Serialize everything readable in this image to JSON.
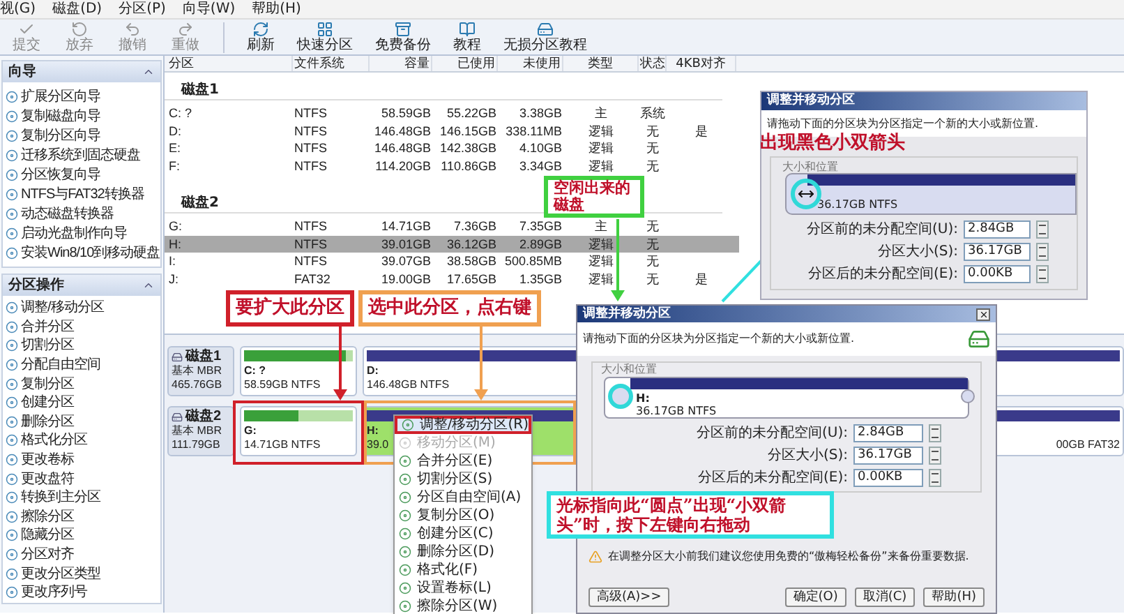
{
  "menu_bar": [
    "视(G)",
    "磁盘(D)",
    "分区(P)",
    "向导(W)",
    "帮助(H)"
  ],
  "toolbar": [
    {
      "label": "提交",
      "disabled": true
    },
    {
      "label": "放弃",
      "disabled": true
    },
    {
      "label": "撤销",
      "disabled": true
    },
    {
      "label": "重做",
      "disabled": true
    },
    {
      "label": "刷新",
      "disabled": false
    },
    {
      "label": "快速分区",
      "disabled": false
    },
    {
      "label": "免费备份",
      "disabled": false
    },
    {
      "label": "教程",
      "disabled": false
    },
    {
      "label": "无损分区教程",
      "disabled": false
    }
  ],
  "sidebar": [
    {
      "title": "向导",
      "items": [
        "扩展分区向导",
        "复制磁盘向导",
        "复制分区向导",
        "迁移系统到固态硬盘",
        "分区恢复向导",
        "NTFS与FAT32转换器",
        "动态磁盘转换器",
        "启动光盘制作向导",
        "安装Win8/10到移动硬盘"
      ]
    },
    {
      "title": "分区操作",
      "items": [
        "调整/移动分区",
        "合并分区",
        "切割分区",
        "分配自由空间",
        "复制分区",
        "创建分区",
        "删除分区",
        "格式化分区",
        "更改卷标",
        "更改盘符",
        "转换到主分区",
        "擦除分区",
        "隐藏分区",
        "分区对齐",
        "更改分区类型",
        "更改序列号"
      ]
    }
  ],
  "table": {
    "columns": [
      "分区",
      "文件系统",
      "容量",
      "已使用",
      "未使用",
      "类型",
      "状态",
      "4KB对齐"
    ],
    "disks": [
      {
        "name": "磁盘1",
        "rows": [
          {
            "cells": [
              "C: ?",
              "NTFS",
              "58.59GB",
              "55.22GB",
              "3.38GB",
              "主",
              "系统",
              ""
            ],
            "selected": false
          },
          {
            "cells": [
              "D:",
              "NTFS",
              "146.48GB",
              "146.15GB",
              "338.11MB",
              "逻辑",
              "无",
              "是"
            ],
            "selected": false
          },
          {
            "cells": [
              "E:",
              "NTFS",
              "146.48GB",
              "142.38GB",
              "4.10GB",
              "逻辑",
              "无",
              ""
            ],
            "selected": false
          },
          {
            "cells": [
              "F:",
              "NTFS",
              "114.20GB",
              "110.86GB",
              "3.34GB",
              "逻辑",
              "无",
              ""
            ],
            "selected": false
          }
        ]
      },
      {
        "name": "磁盘2",
        "rows": [
          {
            "cells": [
              "G:",
              "NTFS",
              "14.71GB",
              "7.36GB",
              "7.35GB",
              "主",
              "无",
              ""
            ],
            "selected": false
          },
          {
            "cells": [
              "H:",
              "NTFS",
              "39.01GB",
              "36.12GB",
              "2.89GB",
              "逻辑",
              "无",
              ""
            ],
            "selected": true
          },
          {
            "cells": [
              "I:",
              "NTFS",
              "39.07GB",
              "38.58GB",
              "500.85MB",
              "逻辑",
              "无",
              ""
            ],
            "selected": false
          },
          {
            "cells": [
              "J:",
              "FAT32",
              "19.00GB",
              "17.65GB",
              "1.35GB",
              "逻辑",
              "无",
              "是"
            ],
            "selected": false
          }
        ]
      }
    ]
  },
  "disk_map": [
    {
      "name": "磁盘1",
      "type": "基本 MBR",
      "size": "465.76GB",
      "partitions": [
        {
          "label": "C: ?",
          "info": "58.59GB NTFS",
          "kind": "primary",
          "level": 0.94,
          "selected": false
        },
        {
          "label": "D:",
          "info": "146.48GB NTFS",
          "kind": "logical",
          "level": 1,
          "selected": false
        }
      ]
    },
    {
      "name": "磁盘2",
      "type": "基本 MBR",
      "size": "111.79GB",
      "partitions": [
        {
          "label": "G:",
          "info": "14.71GB NTFS",
          "kind": "primary",
          "level": 0.5,
          "selected": false
        },
        {
          "label": "H:",
          "info": "39.0",
          "kind": "logical",
          "level": 1,
          "selected": true
        },
        {
          "info": "00GB FAT32",
          "kind": "logical",
          "level": 1,
          "selected": false
        }
      ]
    }
  ],
  "context_menu": [
    {
      "label": "调整/移动分区(R)",
      "disabled": false,
      "selected": true
    },
    {
      "label": "移动分区(M)",
      "disabled": true,
      "selected": false
    },
    {
      "label": "合并分区(E)",
      "disabled": false,
      "selected": false
    },
    {
      "label": "切割分区(S)",
      "disabled": false,
      "selected": false
    },
    {
      "label": "分区自由空间(A)",
      "disabled": false,
      "selected": false
    },
    {
      "label": "复制分区(O)",
      "disabled": false,
      "selected": false
    },
    {
      "label": "创建分区(C)",
      "disabled": false,
      "selected": false
    },
    {
      "label": "删除分区(D)",
      "disabled": false,
      "selected": false
    },
    {
      "label": "格式化(F)",
      "disabled": false,
      "selected": false
    },
    {
      "label": "设置卷标(L)",
      "disabled": false,
      "selected": false
    },
    {
      "label": "擦除分区(W)",
      "disabled": false,
      "selected": false
    }
  ],
  "small_dialog": {
    "title": "调整并移动分区",
    "description": "请拖动下面的分区块为分区指定一个新的大小或新位置.",
    "group": "大小和位置",
    "partition_info": "36.17GB NTFS",
    "level": 0.93,
    "fields": [
      {
        "label": "分区前的未分配空间(U):",
        "value": "2.84GB"
      },
      {
        "label": "分区大小(S):",
        "value": "36.17GB"
      },
      {
        "label": "分区后的未分配空间(E):",
        "value": "0.00KB"
      }
    ]
  },
  "dialog": {
    "title": "调整并移动分区",
    "description": "请拖动下面的分区块为分区指定一个新的大小或新位置.",
    "group": "大小和位置",
    "partition_label": "H:",
    "partition_info": "36.17GB NTFS",
    "level": 0.93,
    "fields": [
      {
        "label": "分区前的未分配空间(U):",
        "value": "2.84GB"
      },
      {
        "label": "分区大小(S):",
        "value": "36.17GB"
      },
      {
        "label": "分区后的未分配空间(E):",
        "value": "0.00KB"
      }
    ],
    "warning": "在调整分区大小前我们建议您使用免费的“傲梅轻松备份”来备份重要数据.",
    "buttons": [
      "高级(A)>>",
      "确定(O)",
      "取消(C)",
      "帮助(H)"
    ]
  },
  "callouts": [
    {
      "text": "要扩大此分区",
      "kind": "red"
    },
    {
      "text": "选中此分区，点右键",
      "kind": "orange"
    },
    {
      "text": "空闲出来的磁盘",
      "kind": "green"
    },
    {
      "text": "出现黑色小双箭头",
      "kind": "plain"
    },
    {
      "text": "光标指向此“圆点”出现“小双箭头”时，按下左键向右拖动",
      "kind": "cyan"
    }
  ]
}
